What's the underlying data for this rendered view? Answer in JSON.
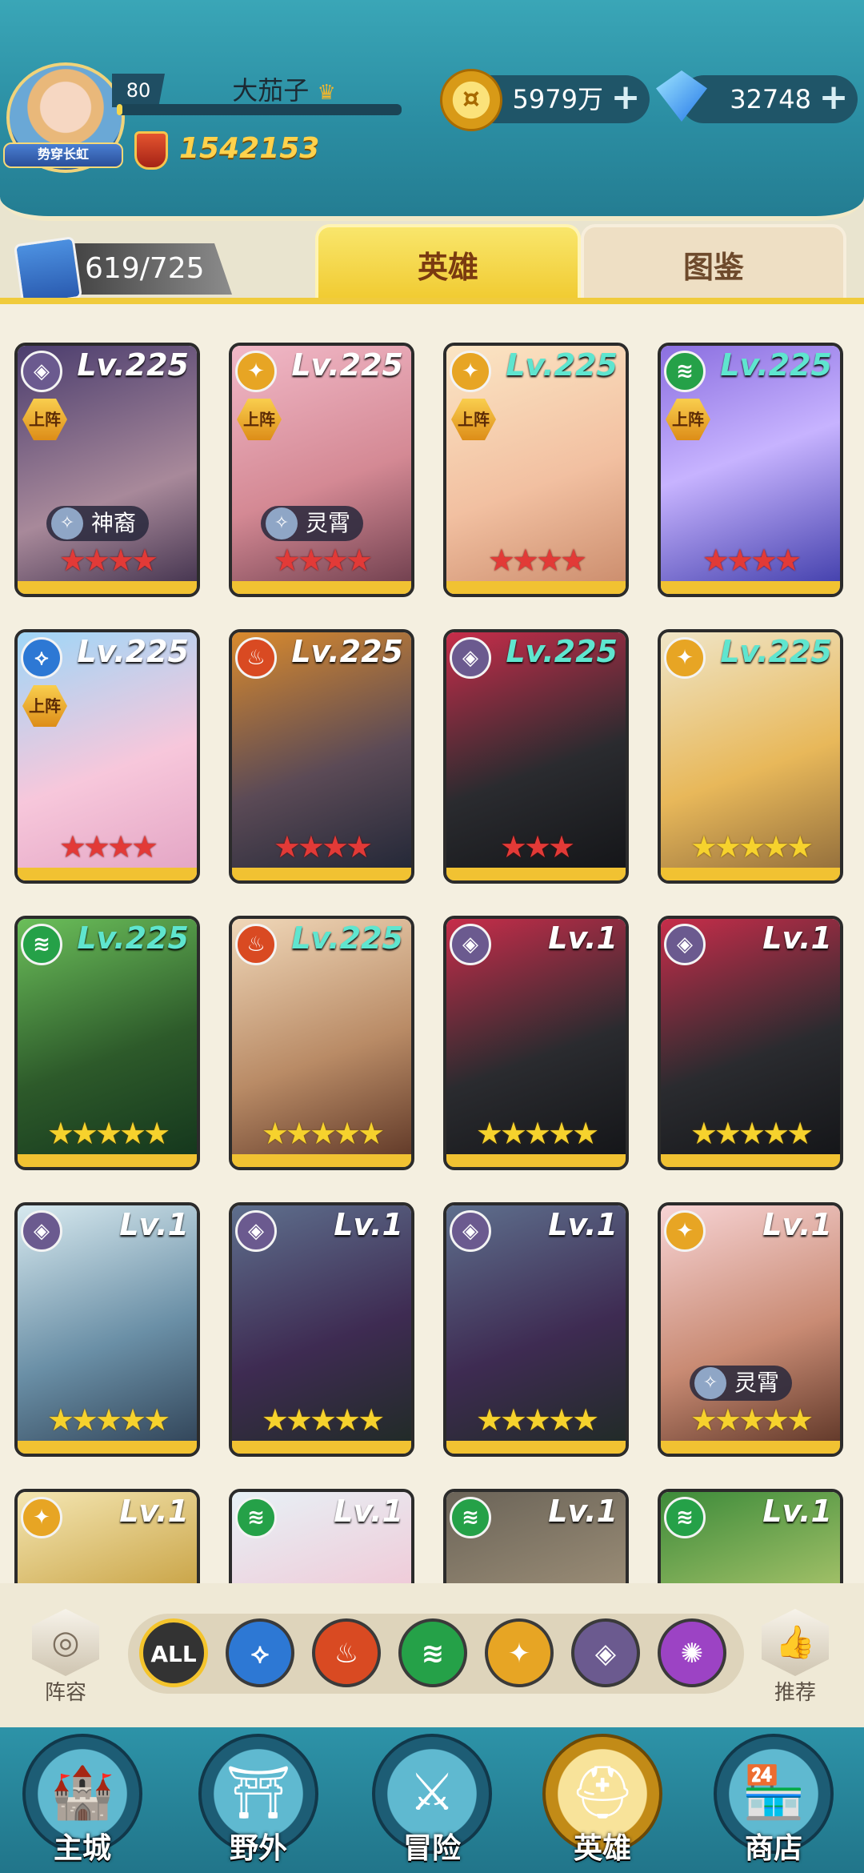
{
  "header": {
    "level": "80",
    "player_name": "大茄子",
    "avatar_badge": "势穿长虹",
    "power": "1542153",
    "gold": "5979万",
    "gems": "32748",
    "exp_progress": 0.02
  },
  "collection": {
    "count": "619/725",
    "tabs": [
      "英雄",
      "图鉴"
    ],
    "active_tab": "英雄"
  },
  "cards": [
    {
      "element": "shadow",
      "level": "Lv.225",
      "deployed": "上阵",
      "tag": "神裔",
      "stars": 4,
      "star_color": "red"
    },
    {
      "element": "holy",
      "level": "Lv.225",
      "deployed": "上阵",
      "tag": "灵霄",
      "stars": 4,
      "star_color": "red"
    },
    {
      "element": "holy",
      "level": "Lv.225",
      "deployed": "上阵",
      "tag": "",
      "stars": 4,
      "star_color": "red"
    },
    {
      "element": "wind",
      "level": "Lv.225",
      "deployed": "上阵",
      "tag": "",
      "stars": 4,
      "star_color": "red"
    },
    {
      "element": "water",
      "level": "Lv.225",
      "deployed": "上阵",
      "tag": "",
      "stars": 4,
      "star_color": "red"
    },
    {
      "element": "fire",
      "level": "Lv.225",
      "deployed": "",
      "tag": "",
      "stars": 4,
      "star_color": "red"
    },
    {
      "element": "shadow",
      "level": "Lv.225",
      "deployed": "",
      "tag": "",
      "stars": 3,
      "star_color": "red"
    },
    {
      "element": "holy",
      "level": "Lv.225",
      "deployed": "",
      "tag": "",
      "stars": 5,
      "star_color": "yellow"
    },
    {
      "element": "wind",
      "level": "Lv.225",
      "deployed": "",
      "tag": "",
      "stars": 5,
      "star_color": "yellow"
    },
    {
      "element": "fire",
      "level": "Lv.225",
      "deployed": "",
      "tag": "",
      "stars": 5,
      "star_color": "yellow"
    },
    {
      "element": "shadow",
      "level": "Lv.1",
      "deployed": "",
      "tag": "",
      "stars": 5,
      "star_color": "yellow"
    },
    {
      "element": "shadow",
      "level": "Lv.1",
      "deployed": "",
      "tag": "",
      "stars": 5,
      "star_color": "yellow"
    },
    {
      "element": "shadow",
      "level": "Lv.1",
      "deployed": "",
      "tag": "",
      "stars": 5,
      "star_color": "yellow"
    },
    {
      "element": "shadow",
      "level": "Lv.1",
      "deployed": "",
      "tag": "",
      "stars": 5,
      "star_color": "yellow"
    },
    {
      "element": "shadow",
      "level": "Lv.1",
      "deployed": "",
      "tag": "",
      "stars": 5,
      "star_color": "yellow"
    },
    {
      "element": "holy",
      "level": "Lv.1",
      "deployed": "",
      "tag": "灵霄",
      "stars": 5,
      "star_color": "yellow"
    },
    {
      "element": "holy",
      "level": "Lv.1",
      "deployed": "",
      "tag": "",
      "stars": 0,
      "star_color": "yellow"
    },
    {
      "element": "wind",
      "level": "Lv.1",
      "deployed": "",
      "tag": "",
      "stars": 0,
      "star_color": "yellow"
    },
    {
      "element": "wind",
      "level": "Lv.1",
      "deployed": "",
      "tag": "",
      "stars": 0,
      "star_color": "yellow"
    },
    {
      "element": "wind",
      "level": "Lv.1",
      "deployed": "",
      "tag": "",
      "stars": 0,
      "star_color": "yellow"
    }
  ],
  "card_gold_levels": [
    2,
    3,
    6,
    7,
    8,
    9
  ],
  "filter": {
    "left_button": "阵容",
    "right_button": "推荐",
    "all_label": "ALL",
    "elements": [
      "water",
      "fire",
      "wind",
      "holy",
      "shadow",
      "arcane"
    ]
  },
  "nav": [
    {
      "label": "主城",
      "icon": "castle-icon"
    },
    {
      "label": "野外",
      "icon": "field-gate-icon"
    },
    {
      "label": "冒险",
      "icon": "sword-icon"
    },
    {
      "label": "英雄",
      "icon": "helmet-icon",
      "active": true
    },
    {
      "label": "商店",
      "icon": "shop-icon"
    }
  ],
  "colors": {
    "header": "#2b8ea3",
    "tab_active": "#f0c92d",
    "red_star": "#e23a37",
    "yellow_star": "#f6d22d"
  }
}
